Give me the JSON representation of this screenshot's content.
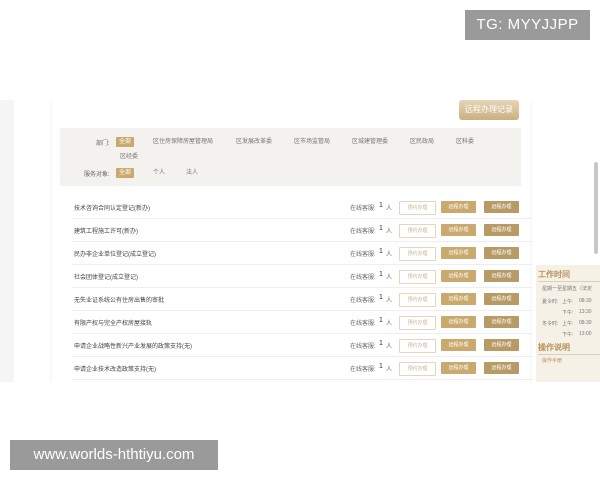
{
  "watermarks": {
    "top_right": "TG: MYYJJPP",
    "bottom_left": "www.worlds-hthtiyu.com"
  },
  "header": {
    "record_button": "远程办理记录"
  },
  "filter": {
    "department_label": "部门:",
    "departments": [
      "全部",
      "区住房保障房屋管理局",
      "区发展改革委",
      "区市场监管局",
      "区城建管理委",
      "区民政局",
      "区科委",
      "区经委"
    ],
    "service_label": "服务对象:",
    "service_targets": [
      "全部",
      "个人",
      "法人"
    ]
  },
  "rows": [
    {
      "name": "技术咨询合同认定登记(新办)",
      "online_label": "在线客服:",
      "online_count": "1",
      "online_unit": "人",
      "btn1": "预约办理",
      "btn2": "远程办理",
      "btn3": "远程办理"
    },
    {
      "name": "建筑工程施工许可(新办)",
      "online_label": "在线客服:",
      "online_count": "1",
      "online_unit": "人",
      "btn1": "预约办理",
      "btn2": "远程办理",
      "btn3": "远程办理"
    },
    {
      "name": "民办非企业单位登记(成立登记)",
      "online_label": "在线客服:",
      "online_count": "1",
      "online_unit": "人",
      "btn1": "预约办理",
      "btn2": "远程办理",
      "btn3": "远程办理"
    },
    {
      "name": "社会团体登记(成立登记)",
      "online_label": "在线客服:",
      "online_count": "1",
      "online_unit": "人",
      "btn1": "预约办理",
      "btn2": "远程办理",
      "btn3": "远程办理"
    },
    {
      "name": "无失业证系统公有住房出售的审批",
      "online_label": "在线客服:",
      "online_count": "1",
      "online_unit": "人",
      "btn1": "预约办理",
      "btn2": "远程办理",
      "btn3": "远程办理"
    },
    {
      "name": "有限产权与完全产权房屋接轨",
      "online_label": "在线客服:",
      "online_count": "1",
      "online_unit": "人",
      "btn1": "预约办理",
      "btn2": "远程办理",
      "btn3": "远程办理"
    },
    {
      "name": "申请企业战略性新兴产业发展的政策支持(无)",
      "online_label": "在线客服:",
      "online_count": "1",
      "online_unit": "人",
      "btn1": "预约办理",
      "btn2": "远程办理",
      "btn3": "远程办理"
    },
    {
      "name": "申请企业技术改造政策支持(无)",
      "online_label": "在线客服:",
      "online_count": "1",
      "online_unit": "人",
      "btn1": "预约办理",
      "btn2": "远程办理",
      "btn3": "远程办理"
    }
  ],
  "sidebar": {
    "work_time_title": "工作时间",
    "weekdays": "星期一至星期五（法定",
    "winter_label": "夏令时:",
    "am": "上午:",
    "am_time": "08:30",
    "pm": "下午:",
    "pm_time": "13:30",
    "summer_label": "冬令时:",
    "am_time2": "08:30",
    "pm_time2": "13:00",
    "op_title": "操作说明",
    "op_link": "操作手册"
  },
  "colors": {
    "gold": "#c9a96e",
    "gold_dark": "#b89a67",
    "filter_bg": "#f4f2ee"
  }
}
